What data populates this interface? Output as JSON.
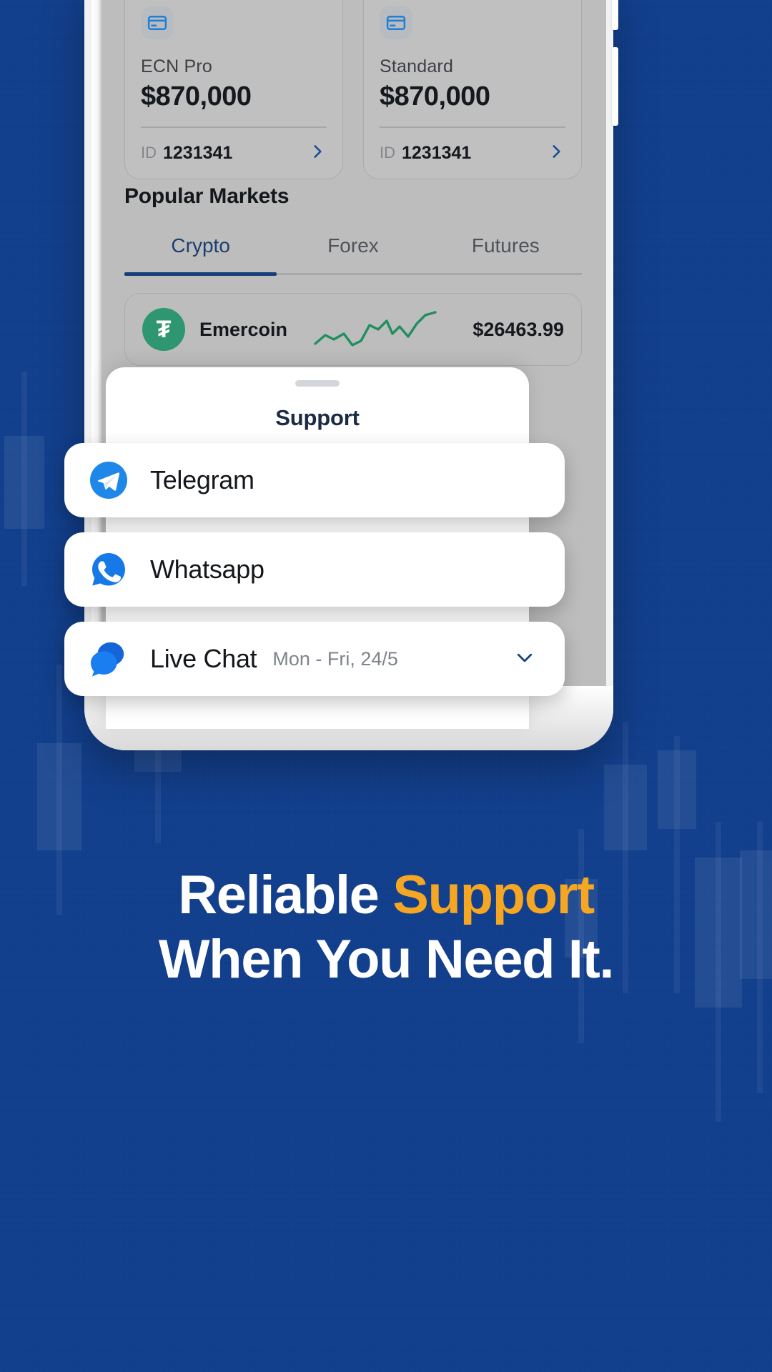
{
  "theme": {
    "background_blue": "#113e8c",
    "accent_amber": "#f5a623",
    "brand_navy": "#153f7a",
    "telegram_blue": "#2196f3",
    "whatsapp_blue": "#1778e8",
    "livechat_blue": "#1a73e8",
    "coin_green": "#2e9671"
  },
  "phone": {
    "accounts": [
      {
        "icon": "credit-card-icon",
        "type": "ECN Pro",
        "balance": "$870,000",
        "id_label": "ID",
        "id_value": "1231341",
        "chevron": "chevron-right-icon"
      },
      {
        "icon": "credit-card-icon",
        "type": "Standard",
        "balance": "$870,000",
        "id_label": "ID",
        "id_value": "1231341",
        "chevron": "chevron-right-icon"
      }
    ],
    "markets": {
      "title": "Popular Markets",
      "tabs": [
        {
          "label": "Crypto",
          "active": true
        },
        {
          "label": "Forex",
          "active": false
        },
        {
          "label": "Futures",
          "active": false
        }
      ],
      "rows": [
        {
          "symbol": "₮",
          "name": "Emercoin",
          "price": "$26463.99",
          "spark": "up-trend-sparkline"
        }
      ]
    }
  },
  "sheet": {
    "grabber": "sheet-grabber",
    "title": "Support",
    "options": [
      {
        "icon": "telegram-icon",
        "label": "Telegram",
        "sub": "",
        "chevron": ""
      },
      {
        "icon": "whatsapp-icon",
        "label": "Whatsapp",
        "sub": "",
        "chevron": ""
      },
      {
        "icon": "live-chat-icon",
        "label": "Live Chat",
        "sub": "Mon - Fri, 24/5",
        "chevron": "chevron-down-icon"
      }
    ]
  },
  "headline": {
    "line1_plain": "Reliable ",
    "line1_accent": "Support",
    "line2": "When You Need It."
  }
}
